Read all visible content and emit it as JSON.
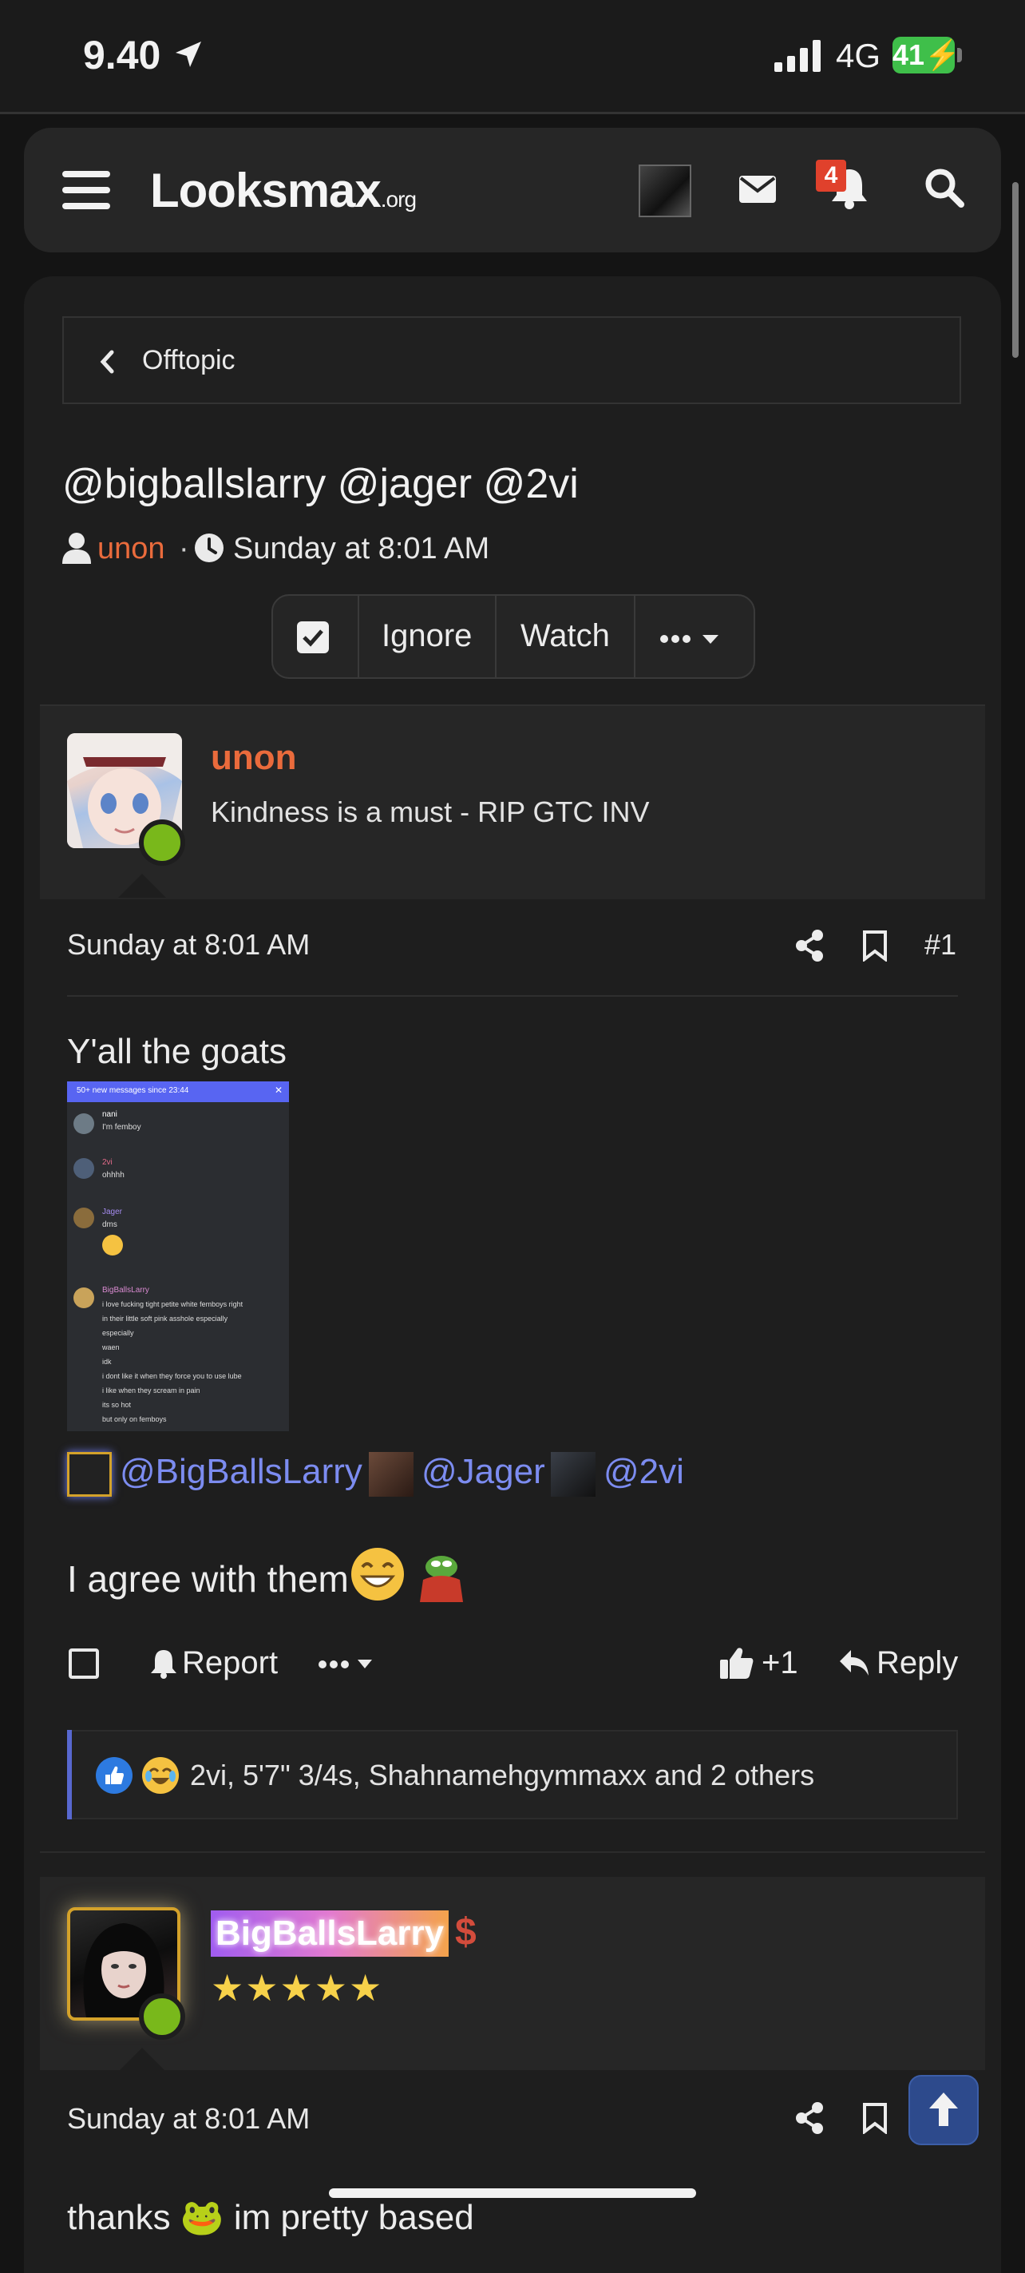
{
  "status_bar": {
    "time": "9.40",
    "network": "4G",
    "battery": "41"
  },
  "header": {
    "logo_main": "Looksmax",
    "logo_suffix": ".org",
    "notification_count": "4"
  },
  "breadcrumb": {
    "label": "Offtopic"
  },
  "thread": {
    "title": "@bigballslarry @jager @2vi",
    "author": "unon",
    "separator": "·",
    "date": "Sunday at 8:01 AM"
  },
  "thread_actions": {
    "ignore": "Ignore",
    "watch": "Watch"
  },
  "post1": {
    "username": "unon",
    "user_title": "Kindness is a must - RIP GTC INV",
    "date": "Sunday at 8:01 AM",
    "number": "#1",
    "text": "Y'all the goats",
    "image_chat": {
      "banner": "50+ new messages since 23:44",
      "messages": [
        {
          "name": "nani",
          "text": "I'm femboy"
        },
        {
          "name": "2vi",
          "text": "ohhhh"
        },
        {
          "name": "Jager",
          "text": "dms"
        },
        {
          "name": "BigBallsLarry",
          "lines": [
            "i love fucking tight petite white femboys right",
            "in their little soft pink asshole especially",
            "especially",
            "waen",
            "idk",
            "i dont like it when they force you to use lube",
            "i like when they scream in pain",
            "its so hot",
            "but only on femboys"
          ]
        }
      ]
    },
    "mentions": [
      "@BigBallsLarry",
      "@Jager",
      "@2vi"
    ],
    "text2": "I agree with them",
    "actions": {
      "report": "Report",
      "like_count": "+1",
      "reply": "Reply"
    },
    "reactions_text": "2vi, 5'7\" 3/4s, Shahnamehgymmaxx and 2 others"
  },
  "post2": {
    "username": "BigBallsLarry",
    "stars": "★★★★★",
    "date": "Sunday at 8:01 AM",
    "text_preview": "thanks 🐸 im pretty based"
  },
  "icons": [
    "location-arrow-icon",
    "signal-icon",
    "battery-icon",
    "menu-icon",
    "mail-icon",
    "bell-icon",
    "search-icon",
    "chevron-left-icon",
    "user-icon",
    "clock-icon",
    "check-icon",
    "ellipsis-icon",
    "caret-down-icon",
    "share-icon",
    "bookmark-icon",
    "thumbs-up-icon",
    "reply-icon",
    "arrow-up-icon"
  ],
  "colors": {
    "accent_orange": "#ea6b3c",
    "mention_blue": "#7c8cf0",
    "online_green": "#79b81b",
    "badge_red": "#e0412c"
  }
}
